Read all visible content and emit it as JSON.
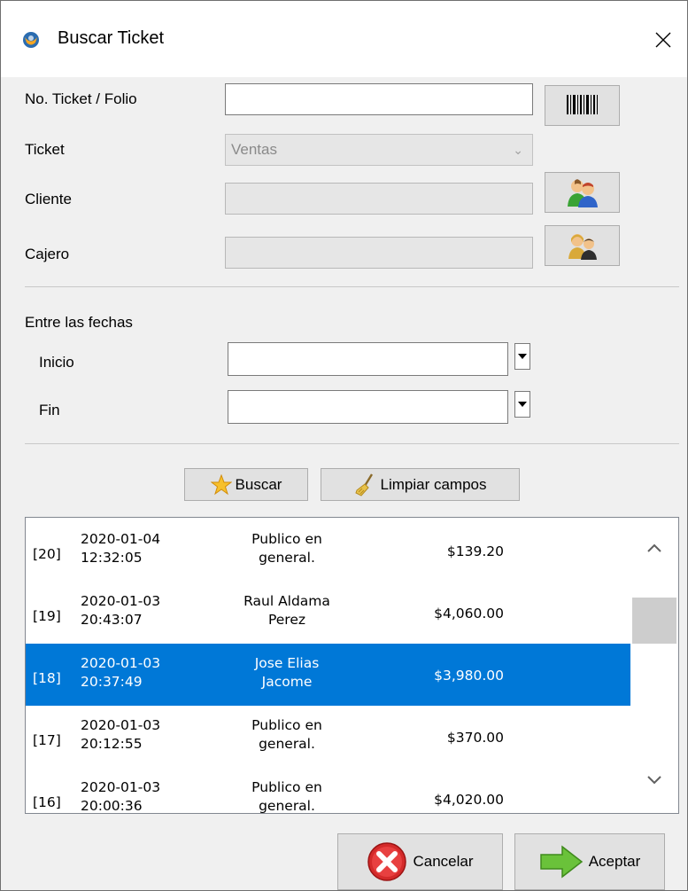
{
  "window": {
    "title": "Buscar Ticket"
  },
  "form": {
    "ticket_folio_label": "No. Ticket / Folio",
    "ticket_folio_value": "",
    "ticket_label": "Ticket",
    "ticket_type_value": "Ventas",
    "cliente_label": "Cliente",
    "cliente_value": "",
    "cajero_label": "Cajero",
    "cajero_value": ""
  },
  "dates": {
    "section_label": "Entre las fechas",
    "inicio_label": "Inicio",
    "inicio_value": "",
    "fin_label": "Fin",
    "fin_value": ""
  },
  "actions": {
    "buscar_label": "Buscar",
    "limpiar_label": "Limpiar campos",
    "cancelar_label": "Cancelar",
    "aceptar_label": "Aceptar"
  },
  "results": [
    {
      "idx": "[20]",
      "date": "2020-01-04",
      "time": "12:32:05",
      "client_1": "Publico en",
      "client_2": "general.",
      "amount": "$139.20",
      "selected": false
    },
    {
      "idx": "[19]",
      "date": "2020-01-03",
      "time": "20:43:07",
      "client_1": "Raul Aldama",
      "client_2": "Perez",
      "amount": "$4,060.00",
      "selected": false
    },
    {
      "idx": "[18]",
      "date": "2020-01-03",
      "time": "20:37:49",
      "client_1": "Jose Elias",
      "client_2": "Jacome",
      "amount": "$3,980.00",
      "selected": true
    },
    {
      "idx": "[17]",
      "date": "2020-01-03",
      "time": "20:12:55",
      "client_1": "Publico en",
      "client_2": "general.",
      "amount": "$370.00",
      "selected": false
    },
    {
      "idx": "[16]",
      "date": "2020-01-03",
      "time": "20:00:36",
      "client_1": "Publico en",
      "client_2": "general.",
      "amount": "$4,020.00",
      "selected": false
    }
  ],
  "colors": {
    "selection": "#0078d7",
    "button_face": "#e1e1e1",
    "window_bg": "#f0f0f0"
  },
  "icons": [
    "app-icon",
    "close-icon",
    "barcode-icon",
    "clients-icon",
    "cashier-icon",
    "star-icon",
    "broom-icon",
    "cancel-icon",
    "arrow-right-icon",
    "scroll-up-icon",
    "scroll-down-icon"
  ]
}
